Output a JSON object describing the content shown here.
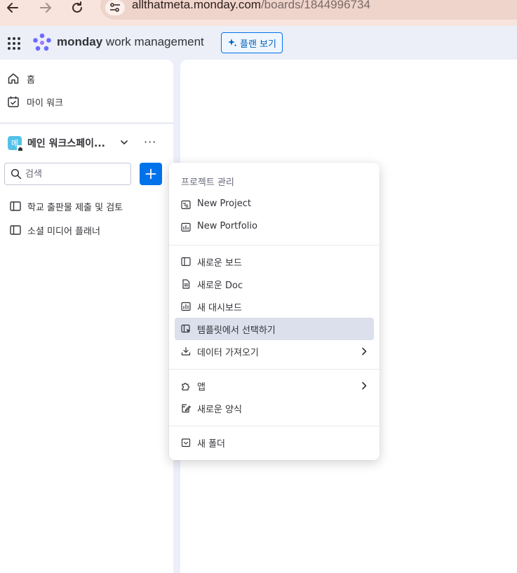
{
  "browser": {
    "url_host": "allthatmeta.monday.com",
    "url_path": "/boards/1844996734"
  },
  "header": {
    "brand_bold": "monday",
    "brand_rest": " work management",
    "plan_button": "플랜 보기"
  },
  "sidebar": {
    "nav": [
      {
        "label": "홈",
        "icon": "home-icon"
      },
      {
        "label": "마이 워크",
        "icon": "calendar-check-icon"
      }
    ],
    "workspace": {
      "badge": "메",
      "name": "메인 워크스페이...",
      "more": "···"
    },
    "search": {
      "placeholder": "검색"
    },
    "boards": [
      {
        "label": "학교 출판물 제출 및 검토",
        "icon": "board-icon"
      },
      {
        "label": "소셜 미디어 플래너",
        "icon": "board-icon"
      }
    ]
  },
  "menu": {
    "header": "프로젝트 관리",
    "groups": [
      [
        {
          "label": "New Project",
          "icon": "project-icon"
        },
        {
          "label": "New Portfolio",
          "icon": "portfolio-icon"
        }
      ],
      [
        {
          "label": "새로운 보드",
          "icon": "board-icon"
        },
        {
          "label": "새로운 Doc",
          "icon": "doc-icon"
        },
        {
          "label": "새 대시보드",
          "icon": "dashboard-icon"
        },
        {
          "label": "템플릿에서 선택하기",
          "icon": "template-icon",
          "active": true
        },
        {
          "label": "데이터 가져오기",
          "icon": "import-icon",
          "submenu": true
        }
      ],
      [
        {
          "label": "앱",
          "icon": "puzzle-icon",
          "submenu": true
        },
        {
          "label": "새로운 양식",
          "icon": "form-icon"
        }
      ],
      [
        {
          "label": "새 폴더",
          "icon": "folder-icon"
        }
      ]
    ]
  },
  "colors": {
    "primary": "#0073ea",
    "active_item": "#dcdfec",
    "browser_bar": "#f8e4dd",
    "app_bg": "#eceff8"
  }
}
